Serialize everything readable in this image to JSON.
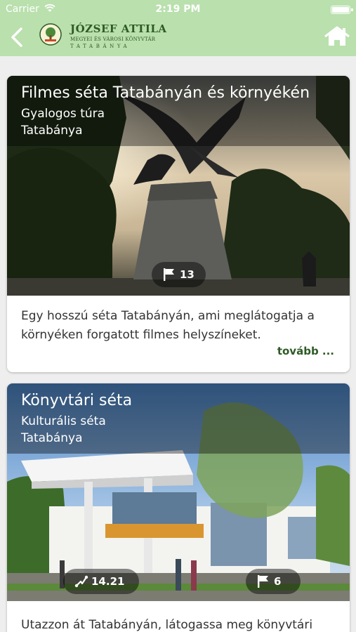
{
  "status_bar": {
    "carrier": "Carrier",
    "time": "2:19 PM"
  },
  "header": {
    "logo_line1": "JÓZSEF ATTILA",
    "logo_line2": "MEGYEI ÉS VÁROSI KÖNYVTÁR",
    "logo_line3": "TATABÁNYA",
    "accent_color": "#b9e0ad",
    "text_color": "#2e5a25",
    "icons": [
      "back-chevron-icon",
      "home-icon"
    ]
  },
  "tours": [
    {
      "title": "Filmes séta Tatabányán és környékén",
      "type": "Gyalogos túra",
      "city": "Tatabánya",
      "stations": "13",
      "description": "Egy hosszú séta Tatabányán, ami meglátogatja a környéken forgatott filmes helyszíneket.",
      "more_label": "tovább ..."
    },
    {
      "title": "Könyvtári séta",
      "type": "Kulturális séta",
      "city": "Tatabánya",
      "distance": "14.21",
      "stations": "6",
      "description": "Utazzon át Tatabányán, látogassa meg könyvtári"
    }
  ]
}
